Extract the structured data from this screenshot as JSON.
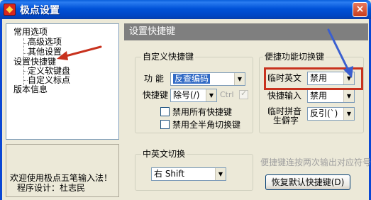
{
  "window": {
    "title": "极点设置",
    "close_label": "×"
  },
  "tree": {
    "items": [
      {
        "label": "常用选项"
      },
      {
        "label": "高级选项"
      },
      {
        "label": "其他设置"
      },
      {
        "label": "设置快捷键"
      },
      {
        "label": "定义软键盘"
      },
      {
        "label": "自定义标点"
      },
      {
        "label": "版本信息"
      }
    ]
  },
  "welcome": {
    "line1": "欢迎使用极点五笔输入法！",
    "line2": "程序设计：杜志民"
  },
  "panel": {
    "header": "设置快捷键"
  },
  "custom_shortcut": {
    "group_title": "自定义快捷键",
    "function_label": "功  能",
    "function_value": "反查编码",
    "shortcut_label": "快捷键",
    "shortcut_value": "除号(/)",
    "ctrl_label": "Ctrl",
    "disable_all_label": "禁用所有快捷键",
    "disable_fullhalf_label": "禁用全半角切换键"
  },
  "cn_en_switch": {
    "group_title": "中英文切换",
    "value": "右 Shift"
  },
  "function_switch": {
    "group_title": "便捷功能切换键",
    "temp_english_label": "临时英文",
    "temp_english_value": "禁用",
    "quick_input_label": "快捷输入",
    "quick_input_value": "禁用",
    "temp_pinyin_label_1": "临时拼音",
    "temp_pinyin_label_2": "生僻字",
    "temp_pinyin_value": "反引(`)"
  },
  "hint": "便捷键连按两次输出对应符号",
  "restore_button": "恢复默认快捷键(D)",
  "colors": {
    "title_blue": "#0052d8",
    "selection": "#316ac5",
    "annotation_red": "#c8321e",
    "annotation_blue": "#3a5fd0"
  }
}
